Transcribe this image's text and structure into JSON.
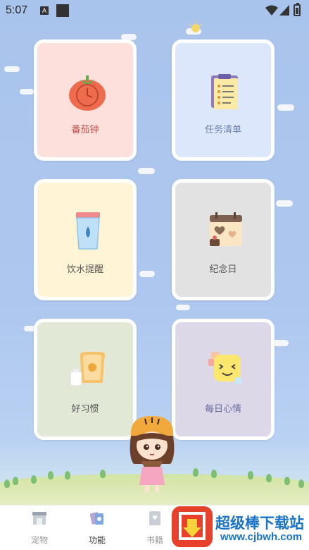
{
  "status_bar": {
    "time": "5:07",
    "notification_letter": "A"
  },
  "cards": [
    {
      "label": "番茄钟",
      "icon": "tomato-timer-icon",
      "bg": "#fde0dc",
      "label_color": "#c0504d"
    },
    {
      "label": "任务清单",
      "icon": "task-list-icon",
      "bg": "#dde7fb",
      "label_color": "#6a7fa8"
    },
    {
      "label": "饮水提醒",
      "icon": "water-cup-icon",
      "bg": "#fff4d6",
      "label_color": "#555555"
    },
    {
      "label": "纪念日",
      "icon": "calendar-hearts-icon",
      "bg": "#e2e2e2",
      "label_color": "#555555"
    },
    {
      "label": "好习惯",
      "icon": "toast-milk-icon",
      "bg": "#e1e8d5",
      "label_color": "#555555"
    },
    {
      "label": "每日心情",
      "icon": "mood-face-icon",
      "bg": "#dcd8e8",
      "label_color": "#6a6a9a"
    }
  ],
  "tabbar": {
    "items": [
      {
        "label": "宠物",
        "icon": "pet-shop-icon",
        "active": false
      },
      {
        "label": "功能",
        "icon": "function-cards-icon",
        "active": true
      },
      {
        "label": "书籍",
        "icon": "book-icon",
        "active": false
      }
    ]
  },
  "watermark": {
    "title": "超级棒下载站",
    "url": "www.cjbwh.com"
  },
  "colors": {
    "card_border": "#ffffff",
    "sky": "#a9c4ec",
    "watermark_blue": "#1a73c9",
    "watermark_red": "#e8412b"
  }
}
